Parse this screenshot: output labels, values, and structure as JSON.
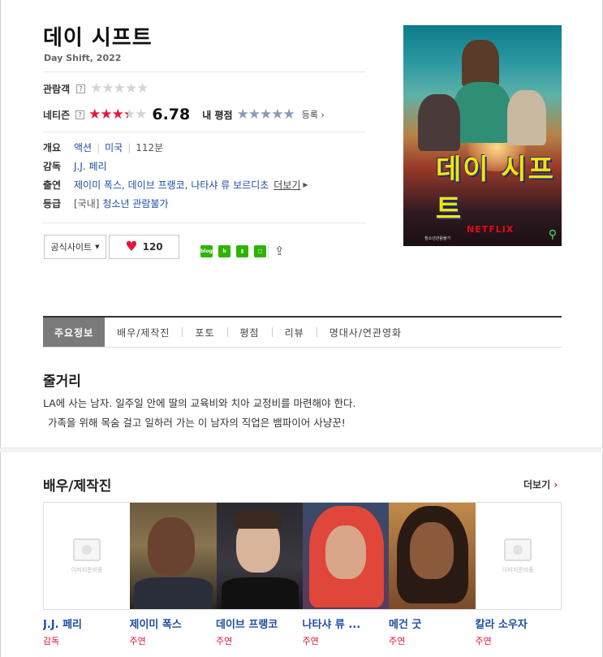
{
  "movie": {
    "title": "데이 시프트",
    "subtitle": "Day Shift, 2022"
  },
  "ratings": {
    "audience_label": "관람객",
    "netizen_label": "네티즌",
    "question_mark": "?",
    "netizen_score": "6.78",
    "netizen_score_value": 6.78,
    "my_rating_label": "내 평점",
    "register_label": "등록"
  },
  "info": {
    "overview_label": "개요",
    "genre": "액션",
    "country": "미국",
    "runtime": "112분",
    "director_label": "감독",
    "director": "J.J. 페리",
    "cast_label": "출연",
    "cast": "제이미 폭스, 데이브 프랭코, 나타샤 류 보르디초",
    "more_label": "더보기",
    "grade_label": "등급",
    "grade_prefix": "[국내]",
    "grade": "청소년 관람불가"
  },
  "actions": {
    "official_site": "공식사이트",
    "like_count": "120",
    "share_icons": [
      "naver-blog-icon",
      "naver-band-icon",
      "bookmark-icon",
      "naver-cafe-icon"
    ]
  },
  "poster": {
    "title": "데이 시프트",
    "brand": "NETFLIX",
    "footer": "청소년관람불가"
  },
  "tabs": [
    "주요정보",
    "배우/제작진",
    "포토",
    "평점",
    "리뷰",
    "명대사/연관영화"
  ],
  "synopsis": {
    "heading": "줄거리",
    "line1": "LA에 사는 남자. 일주일 안에 딸의 교육비와 치아 교정비를 마련해야 한다.",
    "line2": "가족을 위해 목숨 걸고 일하러 가는 이 남자의 직업은 뱀파이어 사냥꾼!"
  },
  "crew": {
    "heading": "배우/제작진",
    "more_label": "더보기",
    "placeholder_text": "이미지준비중",
    "members": [
      {
        "name": "J.J. 페리",
        "role": "감독"
      },
      {
        "name": "제이미 폭스",
        "role": "주연"
      },
      {
        "name": "데이브 프랭코",
        "role": "주연"
      },
      {
        "name": "나타샤 류 ...",
        "role": "주연"
      },
      {
        "name": "메건 굿",
        "role": "주연"
      },
      {
        "name": "칼라 소우자",
        "role": "주연"
      }
    ]
  },
  "colors": {
    "accent_red": "#e3163b",
    "link_blue": "#1f4ea5",
    "tab_active": "#7a7a7a"
  }
}
